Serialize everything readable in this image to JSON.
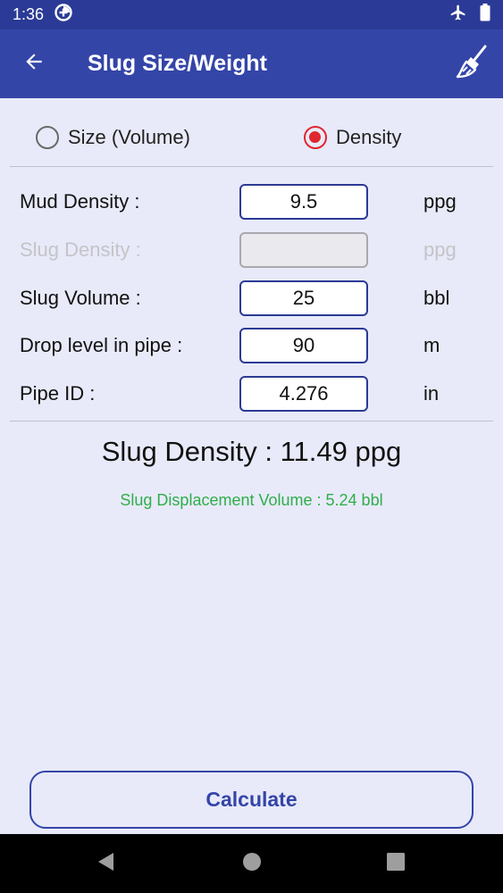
{
  "status_bar": {
    "time": "1:36",
    "icons": [
      "data-saver-icon",
      "airplane-mode-icon",
      "battery-icon"
    ]
  },
  "app_bar": {
    "title": "Slug Size/Weight",
    "back_icon": "back-arrow-icon",
    "clear_icon": "broom-icon",
    "color": "#3445a8"
  },
  "mode": {
    "options": [
      {
        "label": "Size (Volume)",
        "selected": false
      },
      {
        "label": "Density",
        "selected": true
      }
    ],
    "accent": "#e0262e"
  },
  "form": {
    "rows": [
      {
        "label": "Mud Density :",
        "value": "9.5",
        "unit": "ppg",
        "enabled": true
      },
      {
        "label": "Slug Density :",
        "value": "",
        "unit": "ppg",
        "enabled": false
      },
      {
        "label": "Slug Volume :",
        "value": "25",
        "unit": "bbl",
        "enabled": true
      },
      {
        "label": "Drop level in pipe :",
        "value": "90",
        "unit": "m",
        "enabled": true
      },
      {
        "label": "Pipe ID :",
        "value": "4.276",
        "unit": "in",
        "enabled": true
      }
    ]
  },
  "result": {
    "main": "Slug Density : 11.49 ppg",
    "sub": "Slug Displacement Volume : 5.24 bbl",
    "sub_color": "#2fae4a"
  },
  "calculate_label": "Calculate",
  "nav_bar": {
    "icons": [
      "nav-back-icon",
      "nav-home-icon",
      "nav-recents-icon"
    ]
  }
}
